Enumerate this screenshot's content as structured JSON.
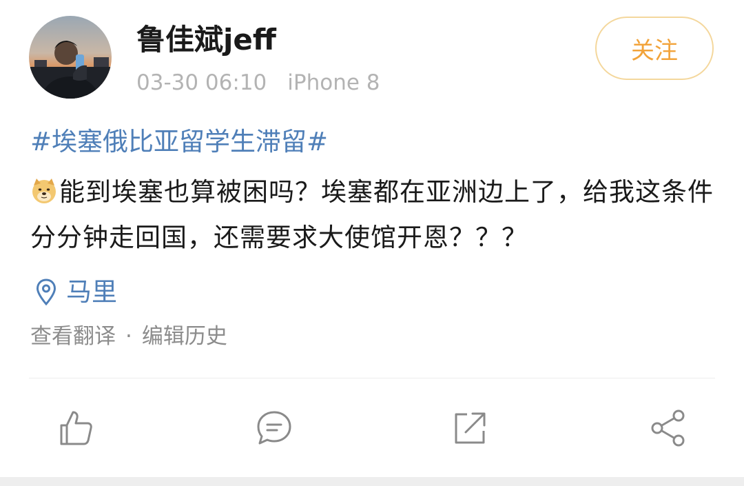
{
  "post": {
    "author": {
      "name": "鲁佳斌jeff",
      "date": "03-30 06:10",
      "device": "iPhone 8"
    },
    "follow_label": "关注",
    "hashtag": "#埃塞俄比亚留学生滞留#",
    "text": "能到埃塞也算被困吗？埃塞都在亚洲边上了，给我这条件分分钟走回国，还需要求大使馆开恩？？？",
    "location": "马里",
    "translate_label": "查看翻译",
    "separator": "·",
    "edit_history_label": "编辑历史"
  },
  "icons": {
    "like": "thumbs-up-icon",
    "comment": "comment-icon",
    "repost": "repost-icon",
    "share": "share-icon",
    "location": "location-pin-icon",
    "emoji": "doge-emoji-icon"
  },
  "colors": {
    "link": "#4f7fb8",
    "follow": "#f2a33a",
    "follow_border": "#f4d79c",
    "meta": "#b3b3b3",
    "icon": "#8a8a8a"
  }
}
